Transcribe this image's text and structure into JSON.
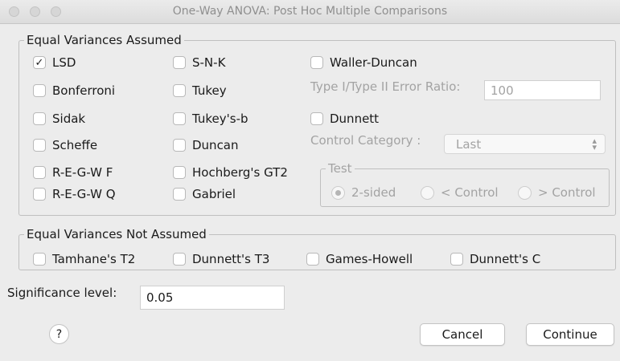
{
  "window": {
    "title": "One-Way ANOVA: Post Hoc Multiple Comparisons"
  },
  "equal_assumed": {
    "legend": "Equal Variances Assumed",
    "options": [
      {
        "label": "LSD",
        "checked": true
      },
      {
        "label": "Bonferroni",
        "checked": false
      },
      {
        "label": "Sidak",
        "checked": false
      },
      {
        "label": "Scheffe",
        "checked": false
      },
      {
        "label": "R-E-G-W F",
        "checked": false
      },
      {
        "label": "R-E-G-W Q",
        "checked": false
      },
      {
        "label": "S-N-K",
        "checked": false
      },
      {
        "label": "Tukey",
        "checked": false
      },
      {
        "label": "Tukey's-b",
        "checked": false
      },
      {
        "label": "Duncan",
        "checked": false
      },
      {
        "label": "Hochberg's GT2",
        "checked": false
      },
      {
        "label": "Gabriel",
        "checked": false
      },
      {
        "label": "Waller-Duncan",
        "checked": false
      },
      {
        "label": "Dunnett",
        "checked": false
      }
    ],
    "error_ratio_label": "Type I/Type II Error Ratio:",
    "error_ratio_value": "100",
    "control_category_label": "Control Category :",
    "control_category_value": "Last",
    "test": {
      "legend": "Test",
      "options": [
        {
          "label": "2-sided",
          "selected": true
        },
        {
          "label": "< Control",
          "selected": false
        },
        {
          "label": "> Control",
          "selected": false
        }
      ]
    }
  },
  "equal_not_assumed": {
    "legend": "Equal Variances Not Assumed",
    "options": [
      {
        "label": "Tamhane's T2",
        "checked": false
      },
      {
        "label": "Dunnett's T3",
        "checked": false
      },
      {
        "label": "Games-Howell",
        "checked": false
      },
      {
        "label": "Dunnett's C",
        "checked": false
      }
    ]
  },
  "significance": {
    "label": "Significance level:",
    "value": "0.05"
  },
  "buttons": {
    "help": "?",
    "cancel": "Cancel",
    "continue": "Continue"
  }
}
